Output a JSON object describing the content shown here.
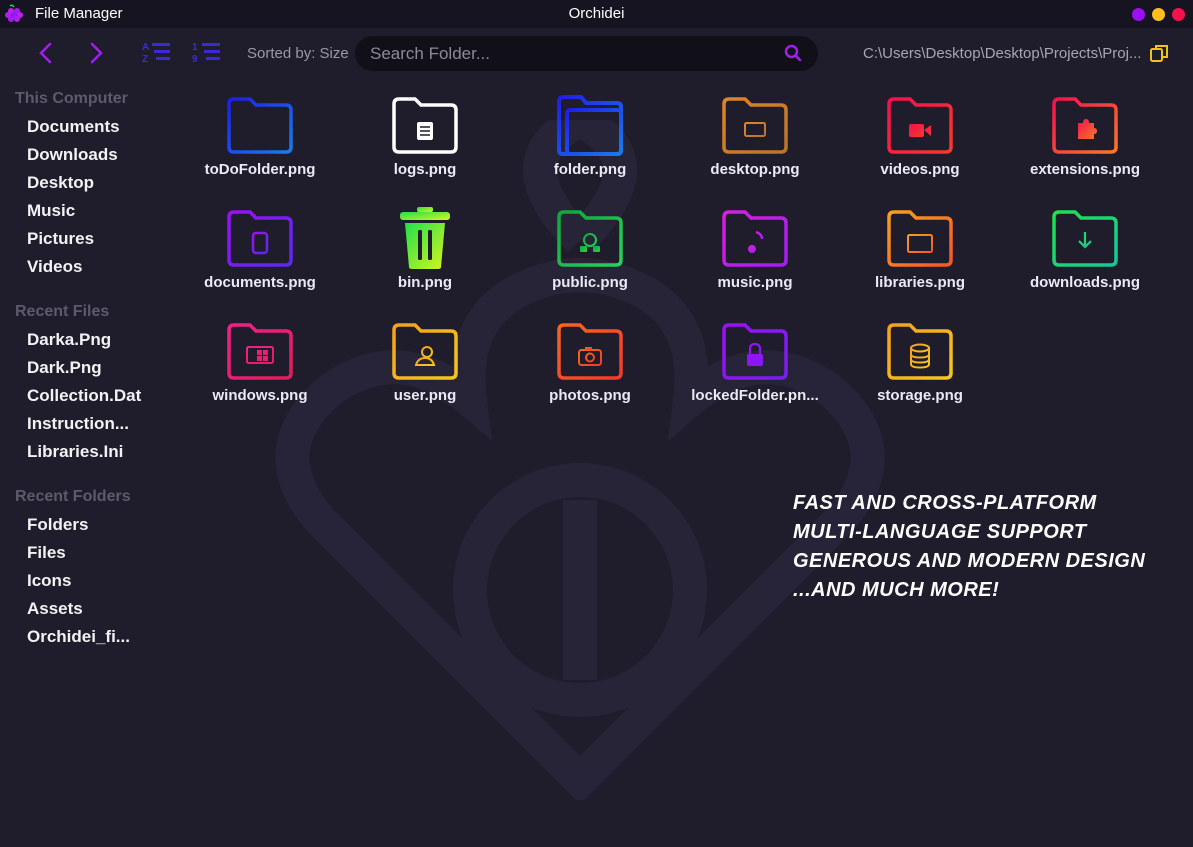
{
  "titlebar": {
    "app_name": "File Manager",
    "window_title": "Orchidei",
    "dots": [
      "#9b10f5",
      "#fcbf1e",
      "#f5104e"
    ]
  },
  "toolbar": {
    "sorted_label": "Sorted by: Size",
    "search_placeholder": "Search Folder...",
    "path": "C:\\Users\\Desktop\\Desktop\\Projects\\Proj...",
    "accent": "#a11ef0",
    "sort_icon_color": "#3b2bd6",
    "copy_icon_color": "#f4c01e"
  },
  "sidebar": {
    "sections": [
      {
        "heading": "This Computer",
        "items": [
          "Documents",
          "Downloads",
          "Desktop",
          "Music",
          "Pictures",
          "Videos"
        ]
      },
      {
        "heading": "Recent Files",
        "items": [
          "Darka.Png",
          "Dark.Png",
          "Collection.Dat",
          "Instruction...",
          "Libraries.Ini"
        ]
      },
      {
        "heading": "Recent Folders",
        "items": [
          "Folders",
          "Files",
          "Icons",
          "Assets",
          "Orchidei_fi..."
        ]
      }
    ]
  },
  "files": [
    {
      "label": "toDoFolder.png",
      "icon": "folder-icon",
      "colors": [
        "#1f1ee8",
        "#1a7ce8"
      ]
    },
    {
      "label": "logs.png",
      "icon": "logs-folder-icon",
      "colors": [
        "#ffffff",
        "#ffffff"
      ]
    },
    {
      "label": "folder.png",
      "icon": "open-folder-icon",
      "colors": [
        "#1f1ee8",
        "#1a7ce8"
      ]
    },
    {
      "label": "desktop.png",
      "icon": "desktop-folder-icon",
      "colors": [
        "#e0842a",
        "#b8752a"
      ]
    },
    {
      "label": "videos.png",
      "icon": "videos-folder-icon",
      "colors": [
        "#f5104e",
        "#f53a2a"
      ]
    },
    {
      "label": "extensions.png",
      "icon": "extensions-folder-icon",
      "colors": [
        "#f5104e",
        "#f57a2a"
      ]
    },
    {
      "label": "documents.png",
      "icon": "documents-folder-icon",
      "colors": [
        "#9b10f5",
        "#5a2af0"
      ]
    },
    {
      "label": "bin.png",
      "icon": "trash-bin-icon",
      "colors": [
        "#21e04a",
        "#d7f51e"
      ]
    },
    {
      "label": "public.png",
      "icon": "public-folder-icon",
      "colors": [
        "#0fa83a",
        "#2ad15a"
      ]
    },
    {
      "label": "music.png",
      "icon": "music-folder-icon",
      "colors": [
        "#d81ee0",
        "#a21ef0"
      ]
    },
    {
      "label": "libraries.png",
      "icon": "libraries-folder-icon",
      "colors": [
        "#f5a01e",
        "#f5572a"
      ]
    },
    {
      "label": "downloads.png",
      "icon": "downloads-folder-icon",
      "colors": [
        "#21e04a",
        "#18c89a"
      ]
    },
    {
      "label": "windows.png",
      "icon": "windows-folder-icon",
      "colors": [
        "#f51e8a",
        "#e01e5a"
      ]
    },
    {
      "label": "user.png",
      "icon": "user-folder-icon",
      "colors": [
        "#f5a01e",
        "#f5c81e"
      ]
    },
    {
      "label": "photos.png",
      "icon": "photos-folder-icon",
      "colors": [
        "#f5661e",
        "#f53a2a"
      ]
    },
    {
      "label": "lockedFolder.pn...",
      "icon": "locked-folder-icon",
      "colors": [
        "#9b10f5",
        "#7a1ef0"
      ]
    },
    {
      "label": "storage.png",
      "icon": "storage-folder-icon",
      "colors": [
        "#f5a01e",
        "#f5c81e"
      ]
    }
  ],
  "features": [
    "Fast and cross-platform",
    "Multi-language support",
    "Generous and modern design",
    "...and much more!"
  ]
}
